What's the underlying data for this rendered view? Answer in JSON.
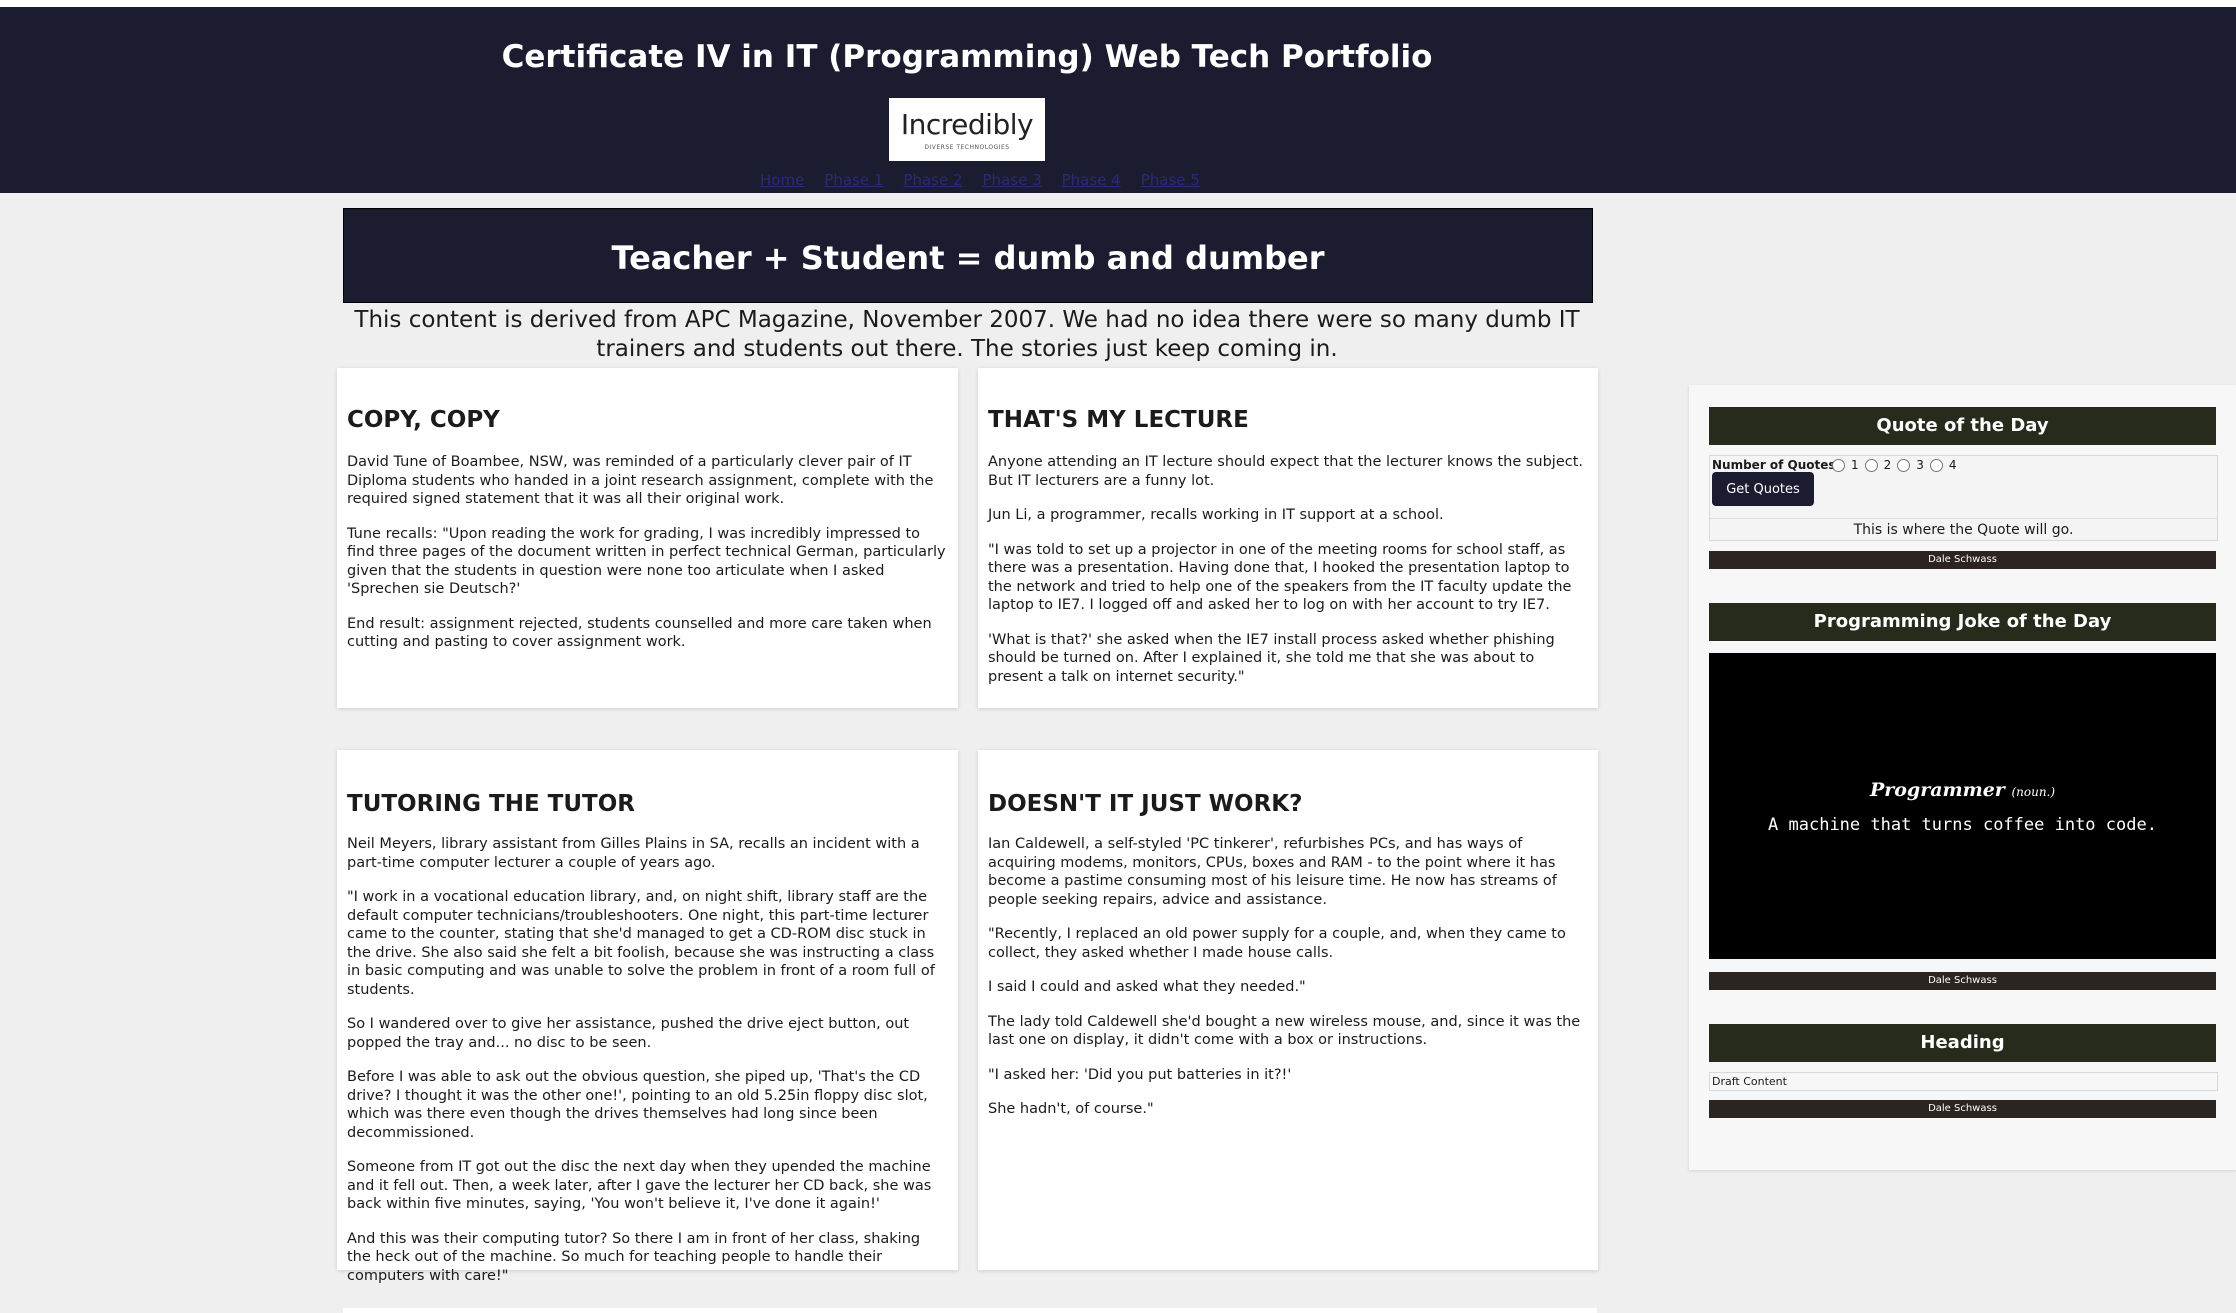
{
  "site": {
    "title": "Certificate IV in IT (Programming) Web Tech Portfolio",
    "logo_text": "Incredibly",
    "logo_subtext": "DIVERSE TECHNOLOGIES",
    "nav": [
      "Home",
      "Phase 1",
      "Phase 2",
      "Phase 3",
      "Phase 4",
      "Phase 5"
    ]
  },
  "article": {
    "title": "Teacher + Student = dumb and dumber",
    "intro": "This content is derived from APC Magazine, November 2007. We had no idea there were so many dumb IT trainers and students out there. The stories just keep coming in.",
    "cards": [
      {
        "heading": "COPY, COPY",
        "paragraphs": [
          "David Tune of Boambee, NSW, was reminded of a particularly clever pair of IT Diploma students who handed in a joint research assignment, complete with the required signed statement that it was all their original work.",
          "Tune recalls: \"Upon reading the work for grading, I was incredibly impressed to find three pages of the document written in perfect technical German, particularly given that the students in question were none too articulate when I asked 'Sprechen sie Deutsch?'",
          "End result: assignment rejected, students counselled and more care taken when cutting and pasting to cover assignment work."
        ]
      },
      {
        "heading": "THAT'S MY LECTURE",
        "paragraphs": [
          "Anyone attending an IT lecture should expect that the lecturer knows the subject. But IT lecturers are a funny lot.",
          "Jun Li, a programmer, recalls working in IT support at a school.",
          "\"I was told to set up a projector in one of the meeting rooms for school staff, as there was a presentation. Having done that, I hooked the presentation laptop to the network and tried to help one of the speakers from the IT faculty update the laptop to IE7. I logged off and asked her to log on with her account to try IE7.",
          "'What is that?' she asked when the IE7 install process asked whether phishing should be turned on. After I explained it, she told me that she was about to present a talk on internet security.\""
        ]
      },
      {
        "heading": "TUTORING THE TUTOR",
        "paragraphs": [
          "Neil Meyers, library assistant from Gilles Plains in SA, recalls an incident with a part-time computer lecturer a couple of years ago.",
          "\"I work in a vocational education library, and, on night shift, library staff are the default computer technicians/troubleshooters. One night, this part-time lecturer came to the counter, stating that she'd managed to get a CD-ROM disc stuck in the drive. She also said she felt a bit foolish, because she was instructing a class in basic computing and was unable to solve the problem in front of a room full of students.",
          "So I wandered over to give her assistance, pushed the drive eject button, out popped the tray and... no disc to be seen.",
          "Before I was able to ask out the obvious question, she piped up, 'That's the CD drive? I thought it was the other one!', pointing to an old 5.25in floppy disc slot, which was there even though the drives themselves had long since been decommissioned.",
          "Someone from IT got out the disc the next day when they upended the machine and it fell out. Then, a week later, after I gave the lecturer her CD back, she was back within five minutes, saying, 'You won't believe it, I've done it again!'",
          "And this was their computing tutor? So there I am in front of her class, shaking the heck out of the machine. So much for teaching people to handle their computers with care!\""
        ]
      },
      {
        "heading": "DOESN'T IT JUST WORK?",
        "paragraphs": [
          "Ian Caldewell, a self-styled 'PC tinkerer', refurbishes PCs, and has ways of acquiring modems, monitors, CPUs, boxes and RAM - to the point where it has become a pastime consuming most of his leisure time. He now has streams of people seeking repairs, advice and assistance.",
          "\"Recently, I replaced an old power supply for a couple, and, when they came to collect, they asked whether I made house calls.",
          "I said I could and asked what they needed.\"",
          "The lady told Caldewell she'd bought a new wireless mouse, and, since it was the last one on display, it didn't come with a box or instructions.",
          "\"I asked her: 'Did you put batteries in it?!'",
          "She hadn't, of course.\""
        ]
      }
    ]
  },
  "sidebar": {
    "quote_widget": {
      "title": "Quote of the Day",
      "count_label": "Number of Quotes:",
      "options": [
        "1",
        "2",
        "3",
        "4"
      ],
      "button_label": "Get Quotes",
      "output": "This is where the Quote will go.",
      "footer": "Dale Schwass"
    },
    "joke_widget": {
      "title": "Programming Joke of the Day",
      "term": "Programmer",
      "pos": "(noun.)",
      "definition": "A machine that turns coffee into code.",
      "footer": "Dale Schwass"
    },
    "heading_widget": {
      "title": "Heading",
      "content": "Draft Content",
      "footer": "Dale Schwass"
    }
  },
  "colors": {
    "header_bg": "#1b1c30",
    "widget_head_bg": "#262b1c",
    "widget_foot_bg": "#2b2420",
    "page_bg": "#efefef"
  }
}
